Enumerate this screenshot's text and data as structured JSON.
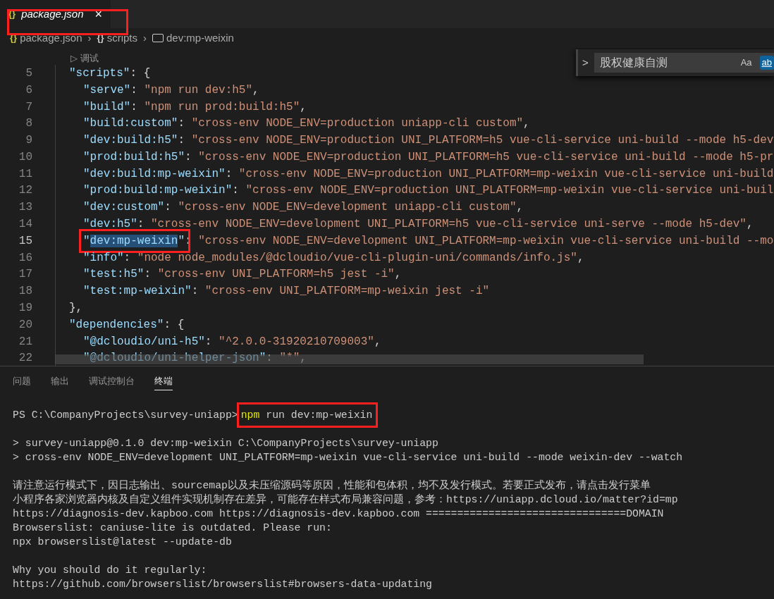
{
  "tabs": [
    {
      "icon": "{}",
      "label": "package.json",
      "selected": true,
      "framed": true,
      "close": "×"
    }
  ],
  "breadcrumb": [
    {
      "kind": "file",
      "icon": "{}",
      "label": "package.json"
    },
    {
      "kind": "object",
      "separator": "›",
      "icon": "{}",
      "label": "scripts"
    },
    {
      "kind": "string",
      "separator": "›",
      "label": "dev:mp-weixin"
    }
  ],
  "codelens": {
    "icon": "▷",
    "label": "调试"
  },
  "find_widget": {
    "toggle": ">",
    "value": "股权健康自测",
    "options": [
      {
        "label": "Aa",
        "selected": false
      },
      {
        "label": "ab",
        "selected": true
      }
    ]
  },
  "editor_lines": [
    {
      "number": "5",
      "kind": "outer",
      "current": false,
      "tokens": [
        {
          "kind": "key",
          "text": "\"scripts\""
        },
        {
          "kind": "punct",
          "text": ": {"
        }
      ]
    },
    {
      "number": "6",
      "kind": "inner",
      "current": false,
      "tokens": [
        {
          "kind": "key",
          "text": "\"serve\""
        },
        {
          "kind": "punct",
          "text": ": "
        },
        {
          "kind": "string",
          "text": "\"npm run dev:h5\""
        },
        {
          "kind": "punct",
          "text": ","
        }
      ]
    },
    {
      "number": "7",
      "kind": "inner",
      "current": false,
      "tokens": [
        {
          "kind": "key",
          "text": "\"build\""
        },
        {
          "kind": "punct",
          "text": ": "
        },
        {
          "kind": "string",
          "text": "\"npm run prod:build:h5\""
        },
        {
          "kind": "punct",
          "text": ","
        }
      ]
    },
    {
      "number": "8",
      "kind": "inner",
      "current": false,
      "tokens": [
        {
          "kind": "key",
          "text": "\"build:custom\""
        },
        {
          "kind": "punct",
          "text": ": "
        },
        {
          "kind": "string",
          "text": "\"cross-env NODE_ENV=production uniapp-cli custom\""
        },
        {
          "kind": "punct",
          "text": ","
        }
      ]
    },
    {
      "number": "9",
      "kind": "inner",
      "current": false,
      "tokens": [
        {
          "kind": "key",
          "text": "\"dev:build:h5\""
        },
        {
          "kind": "punct",
          "text": ": "
        },
        {
          "kind": "string",
          "text": "\"cross-env NODE_ENV=production UNI_PLATFORM=h5 vue-cli-service uni-build --mode h5-dev"
        }
      ]
    },
    {
      "number": "10",
      "kind": "inner",
      "current": false,
      "tokens": [
        {
          "kind": "key",
          "text": "\"prod:build:h5\""
        },
        {
          "kind": "punct",
          "text": ": "
        },
        {
          "kind": "string",
          "text": "\"cross-env NODE_ENV=production UNI_PLATFORM=h5 vue-cli-service uni-build --mode h5-pr"
        }
      ]
    },
    {
      "number": "11",
      "kind": "inner",
      "current": false,
      "tokens": [
        {
          "kind": "key",
          "text": "\"dev:build:mp-weixin\""
        },
        {
          "kind": "punct",
          "text": ": "
        },
        {
          "kind": "string",
          "text": "\"cross-env NODE_ENV=production UNI_PLATFORM=mp-weixin vue-cli-service uni-build"
        }
      ]
    },
    {
      "number": "12",
      "kind": "inner",
      "current": false,
      "tokens": [
        {
          "kind": "key",
          "text": "\"prod:build:mp-weixin\""
        },
        {
          "kind": "punct",
          "text": ": "
        },
        {
          "kind": "string",
          "text": "\"cross-env NODE_ENV=production UNI_PLATFORM=mp-weixin vue-cli-service uni-buil"
        }
      ]
    },
    {
      "number": "13",
      "kind": "inner",
      "current": false,
      "tokens": [
        {
          "kind": "key",
          "text": "\"dev:custom\""
        },
        {
          "kind": "punct",
          "text": ": "
        },
        {
          "kind": "string",
          "text": "\"cross-env NODE_ENV=development uniapp-cli custom\""
        },
        {
          "kind": "punct",
          "text": ","
        }
      ]
    },
    {
      "number": "14",
      "kind": "inner",
      "current": false,
      "tokens": [
        {
          "kind": "key",
          "text": "\"dev:h5\""
        },
        {
          "kind": "punct",
          "text": ": "
        },
        {
          "kind": "string",
          "text": "\"cross-env NODE_ENV=development UNI_PLATFORM=h5 vue-cli-service uni-serve --mode h5-dev\""
        },
        {
          "kind": "punct",
          "text": ","
        }
      ]
    },
    {
      "number": "15",
      "kind": "inner",
      "current": true,
      "key_framed": true,
      "tokens": [
        {
          "kind": "key",
          "text": "\""
        },
        {
          "kind": "key",
          "text": "dev:mp-weixin",
          "highlighted": true
        },
        {
          "kind": "key",
          "text": "\""
        },
        {
          "kind": "punct",
          "text": ": "
        },
        {
          "kind": "string",
          "text": "\"cross-env NODE_ENV=development UNI_PLATFORM=mp-weixin vue-cli-service uni-build --mo"
        }
      ]
    },
    {
      "number": "16",
      "kind": "inner",
      "current": false,
      "tokens": [
        {
          "kind": "key",
          "text": "\"info\""
        },
        {
          "kind": "punct",
          "text": ": "
        },
        {
          "kind": "string",
          "text": "\"node node_modules/@dcloudio/vue-cli-plugin-uni/commands/info.js\""
        },
        {
          "kind": "punct",
          "text": ","
        }
      ]
    },
    {
      "number": "17",
      "kind": "inner",
      "current": false,
      "tokens": [
        {
          "kind": "key",
          "text": "\"test:h5\""
        },
        {
          "kind": "punct",
          "text": ": "
        },
        {
          "kind": "string",
          "text": "\"cross-env UNI_PLATFORM=h5 jest -i\""
        },
        {
          "kind": "punct",
          "text": ","
        }
      ]
    },
    {
      "number": "18",
      "kind": "inner",
      "current": false,
      "tokens": [
        {
          "kind": "key",
          "text": "\"test:mp-weixin\""
        },
        {
          "kind": "punct",
          "text": ": "
        },
        {
          "kind": "string",
          "text": "\"cross-env UNI_PLATFORM=mp-weixin jest -i\""
        }
      ]
    },
    {
      "number": "19",
      "kind": "outer",
      "current": false,
      "tokens": [
        {
          "kind": "punct",
          "text": "},"
        }
      ]
    },
    {
      "number": "20",
      "kind": "outer",
      "current": false,
      "tokens": [
        {
          "kind": "key",
          "text": "\"dependencies\""
        },
        {
          "kind": "punct",
          "text": ": {"
        }
      ]
    },
    {
      "number": "21",
      "kind": "inner",
      "current": false,
      "tokens": [
        {
          "kind": "key",
          "text": "\"@dcloudio/uni-h5\""
        },
        {
          "kind": "punct",
          "text": ": "
        },
        {
          "kind": "string",
          "text": "\"^2.0.0-31920210709003\""
        },
        {
          "kind": "punct",
          "text": ","
        }
      ]
    },
    {
      "number": "22",
      "kind": "inner",
      "current": false,
      "tokens": [
        {
          "kind": "key",
          "text": "\"@dcloudio/uni-helper-json\""
        },
        {
          "kind": "punct",
          "text": ": "
        },
        {
          "kind": "string",
          "text": "\"*\""
        },
        {
          "kind": "punct",
          "text": ","
        }
      ]
    }
  ],
  "panel_tabs": [
    {
      "label": "问题",
      "selected": false
    },
    {
      "label": "输出",
      "selected": false
    },
    {
      "label": "调试控制台",
      "selected": false
    },
    {
      "label": "终端",
      "selected": true
    }
  ],
  "terminal": {
    "prompt": "PS C:\\CompanyProjects\\survey-uniapp>",
    "command": [
      {
        "kind": "program",
        "text": "npm"
      },
      {
        "kind": "args",
        "text": "run dev:mp-weixin"
      }
    ],
    "command_framed": true,
    "output_blocks": [
      [
        "> survey-uniapp@0.1.0 dev:mp-weixin C:\\CompanyProjects\\survey-uniapp",
        "> cross-env NODE_ENV=development UNI_PLATFORM=mp-weixin vue-cli-service uni-build --mode weixin-dev --watch"
      ],
      [
        "请注意运行模式下，因日志输出、sourcemap以及未压缩源码等原因，性能和包体积，均不及发行模式。若要正式发布，请点击发行菜单",
        "小程序各家浏览器内核及自定义组件实现机制存在差异，可能存在样式布局兼容问题，参考：https://uniapp.dcloud.io/matter?id=mp",
        "https://diagnosis-dev.kapboo.com https://diagnosis-dev.kapboo.com ================================DOMAIN",
        "Browserslist: caniuse-lite is outdated. Please run:",
        "npx browserslist@latest --update-db"
      ],
      [
        "Why you should do it regularly:",
        "https://github.com/browserslist/browserslist#browsers-data-updating"
      ]
    ]
  }
}
